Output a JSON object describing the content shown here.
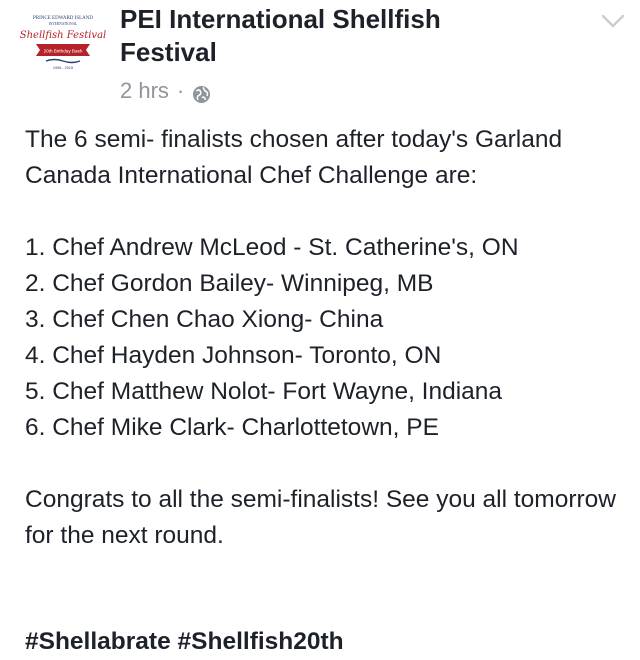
{
  "post": {
    "page_name": "PEI International Shellfish Festival",
    "timestamp": "2 hrs",
    "separator": "·",
    "privacy_icon": "globe-icon",
    "menu_icon": "chevron-down-icon",
    "logo": {
      "top_text": "PRINCE EDWARD ISLAND",
      "sub_text": "INTERNATIONAL",
      "script_text": "Shellfish Festival",
      "ribbon_text": "20th Birthday Bash",
      "years_text": "1996 - 2015"
    },
    "intro": "The 6 semi- finalists chosen after today's Garland Canada International Chef Challenge are:",
    "finalists": [
      "1. Chef Andrew McLeod - St. Catherine's, ON",
      "2. Chef Gordon Bailey- Winnipeg, MB",
      "3. Chef Chen Chao Xiong- China",
      "4. Chef Hayden Johnson- Toronto, ON",
      "5. Chef Matthew Nolot- Fort Wayne, Indiana",
      "6. Chef Mike Clark- Charlottetown, PE"
    ],
    "closing": "Congrats to all the semi-finalists! See you all tomorrow for the next round.",
    "hashtags": [
      "#Shellabrate",
      "#Shellfish20th"
    ]
  },
  "colors": {
    "text": "#1d2129",
    "meta": "#90949c",
    "logo_red": "#b5232a",
    "logo_navy": "#2b3f73"
  }
}
